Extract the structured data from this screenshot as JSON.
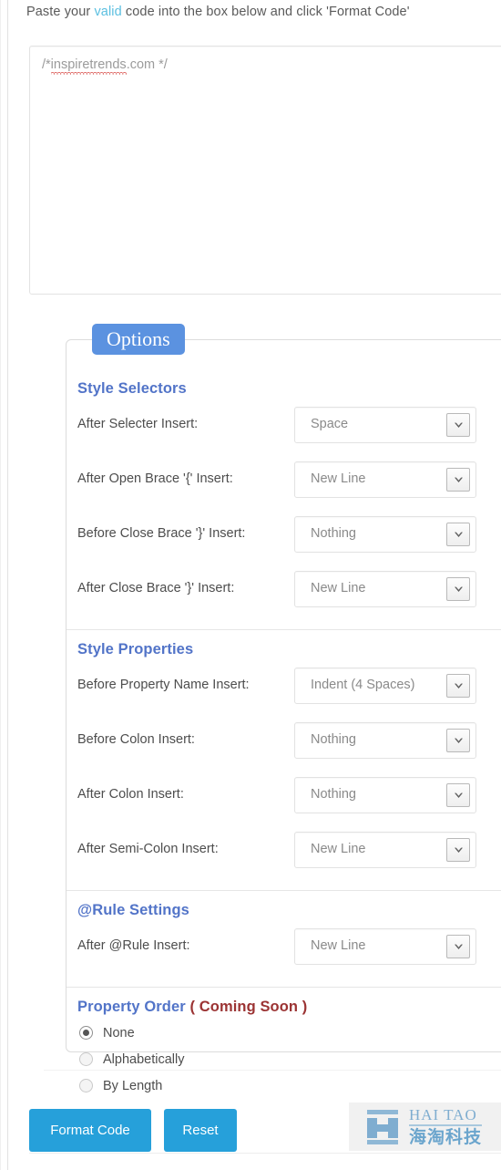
{
  "intro": {
    "before": "Paste your ",
    "link": "valid",
    "after": " code into the box below and click 'Format Code'"
  },
  "code_input": {
    "placeholder_prefix": "/*",
    "placeholder_misspelled": "inspiretrends",
    "placeholder_suffix": ".com */",
    "value": ""
  },
  "panel": {
    "legend": "Options",
    "sections": [
      {
        "heading": "Style Selectors",
        "options": [
          {
            "label": "After Selecter Insert:",
            "value": "Space",
            "width": "w-std"
          },
          {
            "label": "After Open Brace '{' Insert:",
            "value": "New Line",
            "width": "w-std"
          },
          {
            "label": "Before Close Brace '}' Insert:",
            "value": "Nothing",
            "width": "w-std"
          },
          {
            "label": "After Close Brace '}' Insert:",
            "value": "New Line",
            "width": "w-std"
          }
        ]
      },
      {
        "heading": "Style Properties",
        "options": [
          {
            "label": "Before Property Name Insert:",
            "value": "Indent (4 Spaces)",
            "width": "w-wide"
          },
          {
            "label": "Before Colon Insert:",
            "value": "Nothing",
            "width": "w-std"
          },
          {
            "label": "After Colon Insert:",
            "value": "Nothing",
            "width": "w-std"
          },
          {
            "label": "After Semi-Colon Insert:",
            "value": "New Line",
            "width": "w-std"
          }
        ]
      },
      {
        "heading": "@Rule Settings",
        "options": [
          {
            "label": "After @Rule Insert:",
            "value": "New Line",
            "width": "w-std"
          }
        ]
      }
    ],
    "property_order": {
      "heading": "Property Order",
      "badge": "( Coming Soon )",
      "radios": [
        {
          "label": "None",
          "checked": true
        },
        {
          "label": "Alphabetically",
          "checked": false
        },
        {
          "label": "By Length",
          "checked": false
        }
      ]
    }
  },
  "footer": {
    "format_label": "Format Code",
    "reset_label": "Reset"
  },
  "logo": {
    "english": "HAI TAO",
    "chinese": "海淘科技"
  },
  "colors": {
    "accent_blue": "#26a0da",
    "legend_blue": "#5b92e0",
    "heading_blue": "#5274c8",
    "coming_soon_red": "#9b3333",
    "link_blue": "#5bbfe0",
    "logo_blue": "#7fadd0"
  }
}
